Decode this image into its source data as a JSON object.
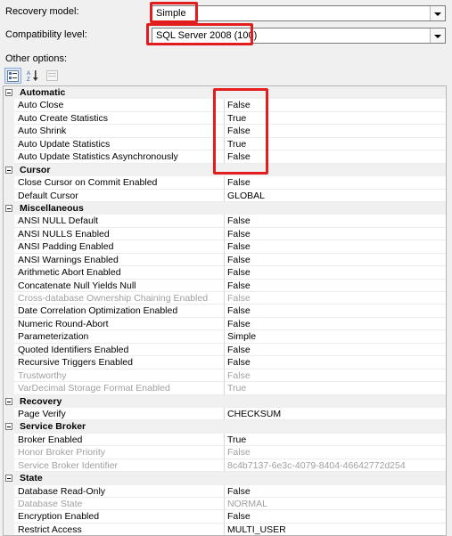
{
  "form": {
    "recovery_model_label": "Recovery model:",
    "recovery_model_value": "Simple",
    "compat_label": "Compatibility level:",
    "compat_value": "SQL Server 2008 (100)",
    "other_options_label": "Other options:"
  },
  "toolbar": {
    "categorized_icon": "categorized-icon",
    "alphabetical_icon": "alphabetical-icon",
    "property_pages_icon": "property-pages-icon"
  },
  "highlight_color": "#e21d1d",
  "categories": [
    {
      "name": "Automatic",
      "props": [
        {
          "name": "Auto Close",
          "value": "False"
        },
        {
          "name": "Auto Create Statistics",
          "value": "True"
        },
        {
          "name": "Auto Shrink",
          "value": "False"
        },
        {
          "name": "Auto Update Statistics",
          "value": "True"
        },
        {
          "name": "Auto Update Statistics Asynchronously",
          "value": "False"
        }
      ]
    },
    {
      "name": "Cursor",
      "props": [
        {
          "name": "Close Cursor on Commit Enabled",
          "value": "False"
        },
        {
          "name": "Default Cursor",
          "value": "GLOBAL"
        }
      ]
    },
    {
      "name": "Miscellaneous",
      "props": [
        {
          "name": "ANSI NULL Default",
          "value": "False"
        },
        {
          "name": "ANSI NULLS Enabled",
          "value": "False"
        },
        {
          "name": "ANSI Padding Enabled",
          "value": "False"
        },
        {
          "name": "ANSI Warnings Enabled",
          "value": "False"
        },
        {
          "name": "Arithmetic Abort Enabled",
          "value": "False"
        },
        {
          "name": "Concatenate Null Yields Null",
          "value": "False"
        },
        {
          "name": "Cross-database Ownership Chaining Enabled",
          "value": "False",
          "disabled": true
        },
        {
          "name": "Date Correlation Optimization Enabled",
          "value": "False"
        },
        {
          "name": "Numeric Round-Abort",
          "value": "False"
        },
        {
          "name": "Parameterization",
          "value": "Simple"
        },
        {
          "name": "Quoted Identifiers Enabled",
          "value": "False"
        },
        {
          "name": "Recursive Triggers Enabled",
          "value": "False"
        },
        {
          "name": "Trustworthy",
          "value": "False",
          "disabled": true
        },
        {
          "name": "VarDecimal Storage Format Enabled",
          "value": "True",
          "disabled": true
        }
      ]
    },
    {
      "name": "Recovery",
      "props": [
        {
          "name": "Page Verify",
          "value": "CHECKSUM"
        }
      ]
    },
    {
      "name": "Service Broker",
      "props": [
        {
          "name": "Broker Enabled",
          "value": "True"
        },
        {
          "name": "Honor Broker Priority",
          "value": "False",
          "disabled": true
        },
        {
          "name": "Service Broker Identifier",
          "value": "8c4b7137-6e3c-4079-8404-46642772d254",
          "disabled": true
        }
      ]
    },
    {
      "name": "State",
      "props": [
        {
          "name": "Database Read-Only",
          "value": "False"
        },
        {
          "name": "Database State",
          "value": "NORMAL",
          "disabled": true
        },
        {
          "name": "Encryption Enabled",
          "value": "False"
        },
        {
          "name": "Restrict Access",
          "value": "MULTI_USER"
        }
      ]
    }
  ]
}
